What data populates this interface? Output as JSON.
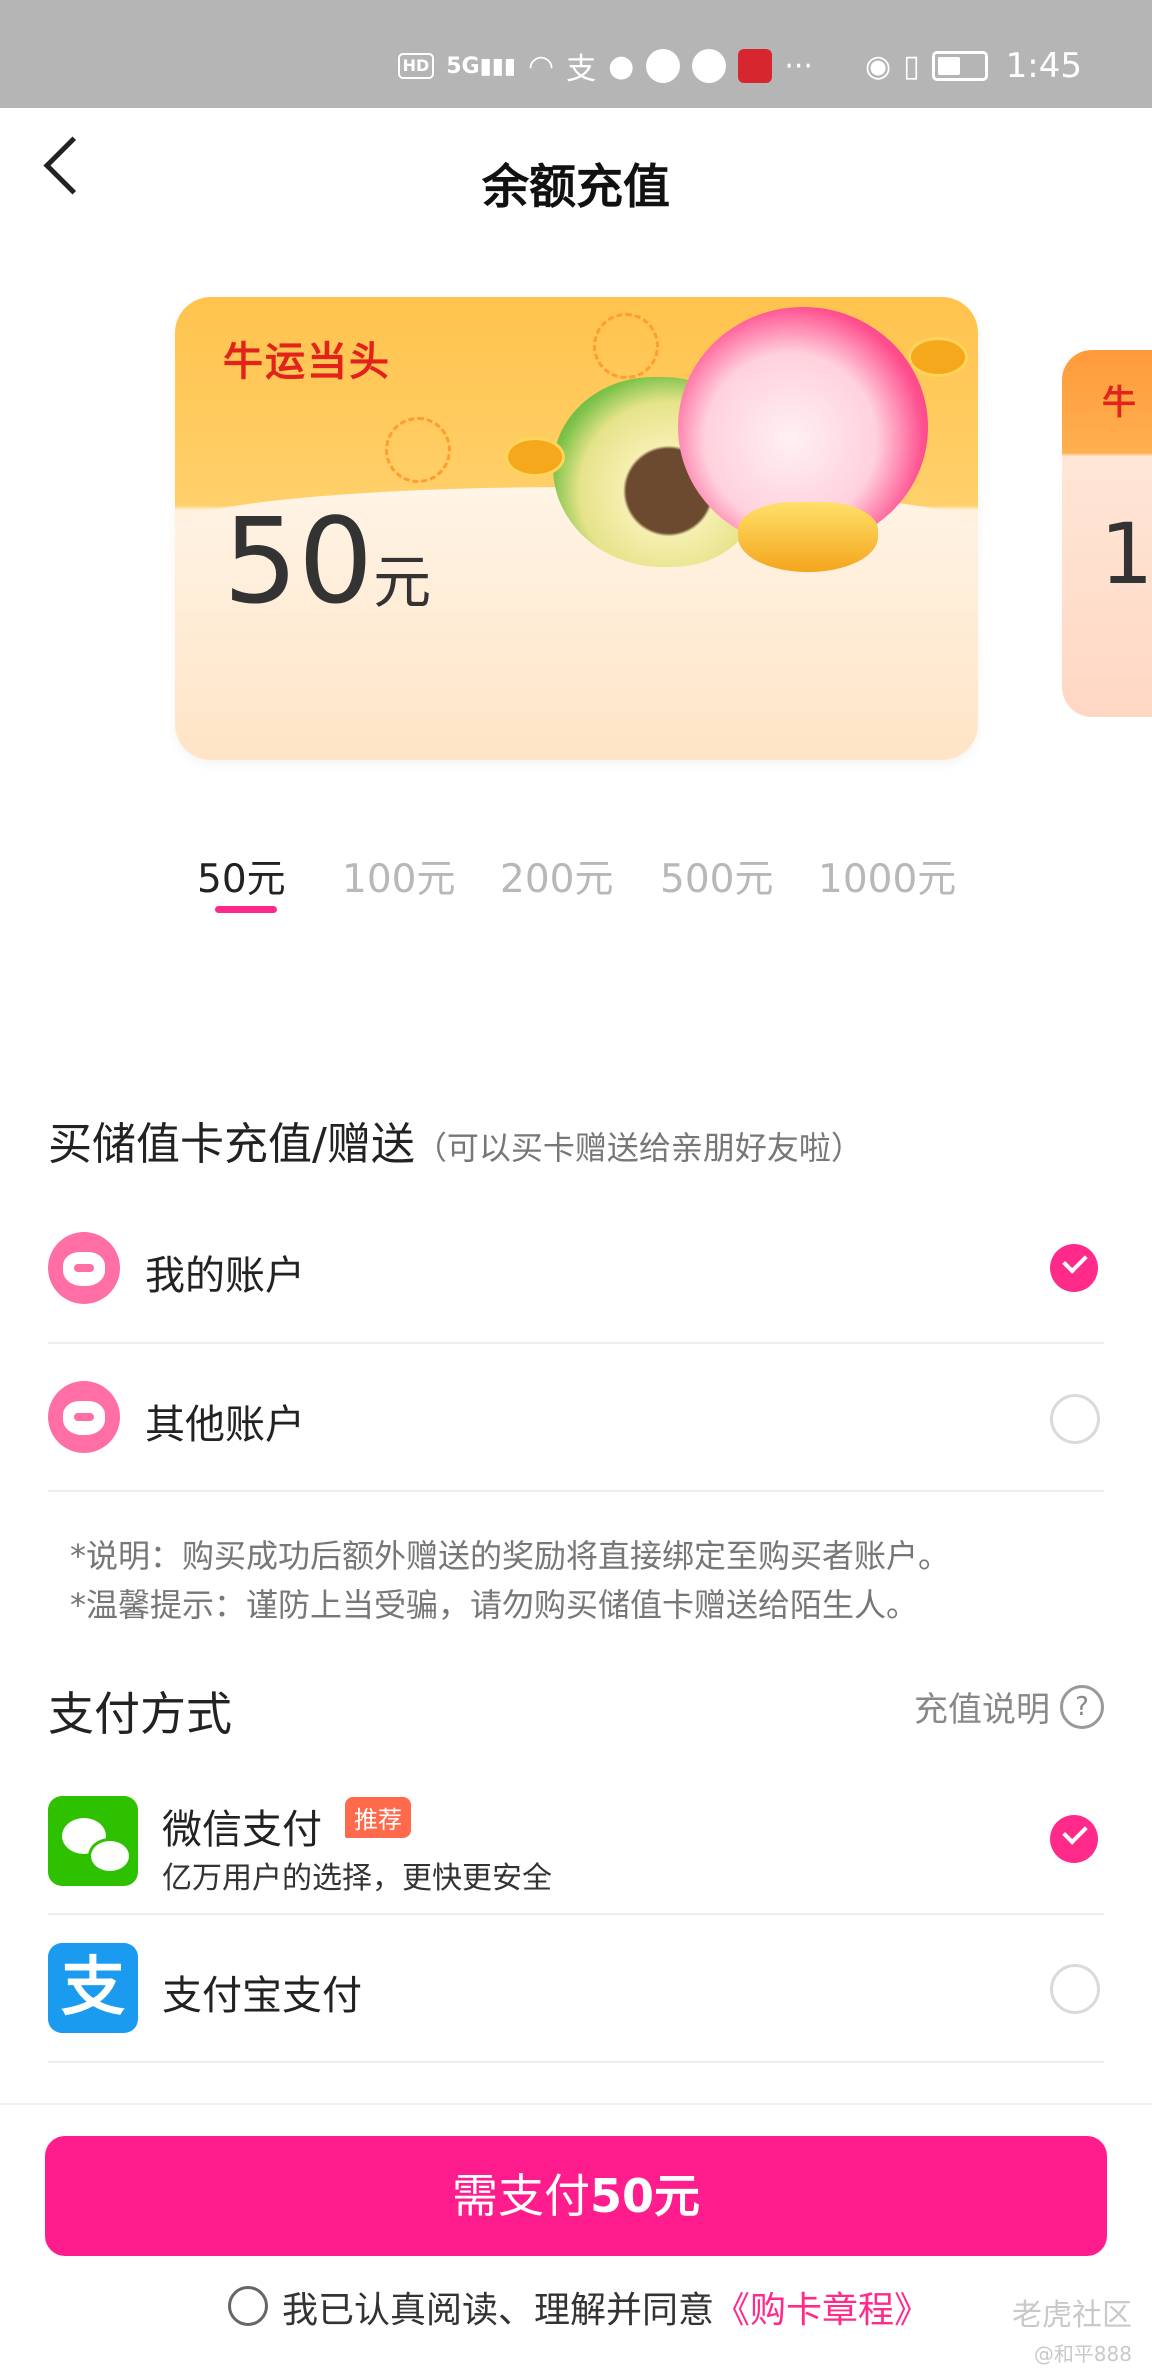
{
  "status_bar": {
    "hd_label": "HD",
    "network_label": "5G",
    "time": "1:45"
  },
  "nav": {
    "title": "余额充值",
    "back_icon": "chevron-left-icon"
  },
  "cards": [
    {
      "slogan": "牛运当头",
      "amount": "50",
      "unit": "元"
    },
    {
      "slogan": "牛",
      "amount": "1"
    }
  ],
  "amount_tabs": [
    {
      "label": "50元",
      "selected": true
    },
    {
      "label": "100元",
      "selected": false
    },
    {
      "label": "200元",
      "selected": false
    },
    {
      "label": "500元",
      "selected": false
    },
    {
      "label": "1000元",
      "selected": false
    }
  ],
  "recipient": {
    "title": "买储值卡充值/赠送",
    "hint": "（可以买卡赠送给亲朋好友啦）",
    "options": [
      {
        "label": "我的账户",
        "checked": true
      },
      {
        "label": "其他账户",
        "checked": false
      }
    ],
    "notes": [
      "*说明：购买成功后额外赠送的奖励将直接绑定至购买者账户。",
      "*温馨提示：谨防上当受骗，请勿购买储值卡赠送给陌生人。"
    ]
  },
  "payment": {
    "title": "支付方式",
    "help_label": "充值说明",
    "help_icon_glyph": "?",
    "methods": [
      {
        "name": "微信支付",
        "badge": "推荐",
        "subtitle": "亿万用户的选择，更快更安全",
        "checked": true,
        "icon": "wechat-pay-icon"
      },
      {
        "name": "支付宝支付",
        "checked": false,
        "icon": "alipay-icon",
        "icon_glyph": "支"
      }
    ]
  },
  "footer": {
    "pay_button_prefix": "需支付",
    "pay_button_amount": "50元",
    "agree_text": "我已认真阅读、理解并同意",
    "agree_link": "《购卡章程》",
    "agree_checked": false
  },
  "watermark": {
    "text": "老虎社区",
    "user": "@和平888"
  },
  "colors": {
    "accent": "#ff1c8d",
    "wechat": "#2dc100",
    "alipay": "#1a9bf0",
    "status_bar": "#b5b5b5"
  }
}
